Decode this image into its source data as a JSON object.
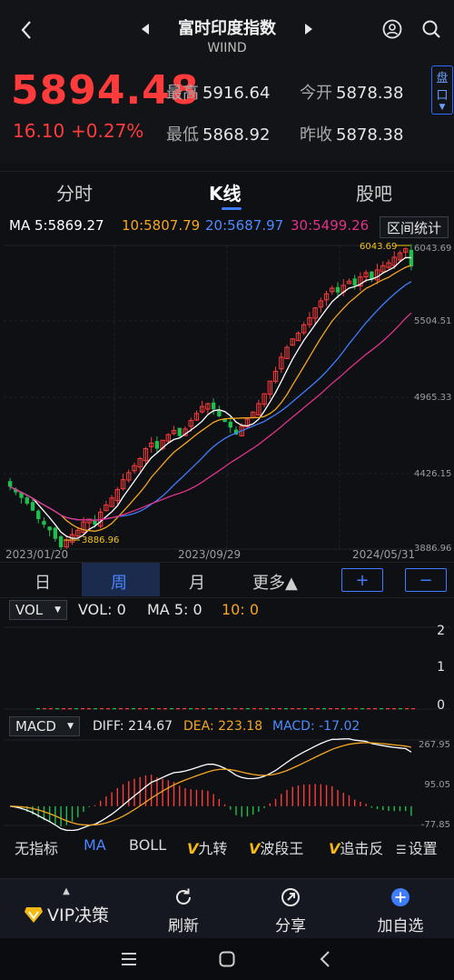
{
  "header": {
    "title": "富时印度指数",
    "subtitle": "WIIND"
  },
  "quote": {
    "price": "5894.48",
    "change": "16.10",
    "change_pct": "+0.27%",
    "high_label": "最高",
    "high": "5916.64",
    "open_label": "今开",
    "open": "5878.38",
    "low_label": "最低",
    "low": "5868.92",
    "prev_close_label": "昨收",
    "prev_close": "5878.38",
    "side_button": [
      "盘",
      "口"
    ]
  },
  "tabs": {
    "items": [
      "分时",
      "K线",
      "股吧"
    ],
    "active": "K线"
  },
  "ma": {
    "ma5": "MA 5:5869.27",
    "ma10": "10:5807.79",
    "ma20": "20:5687.97",
    "ma30": "30:5499.26",
    "range_button": "区间统计"
  },
  "chart_labels": {
    "y_ticks": [
      "6043.69",
      "5504.51",
      "4965.33",
      "4426.15",
      "3886.96"
    ],
    "x_ticks": [
      "2023/01/20",
      "2023/09/29",
      "2024/05/31"
    ],
    "max_label": "6043.69",
    "min_label": "3886.96"
  },
  "period_bar": {
    "items": [
      "日",
      "周",
      "月",
      "更多▲"
    ],
    "active": "周",
    "plus": "+",
    "minus": "−"
  },
  "vol": {
    "selector": "VOL",
    "vol": "VOL: 0",
    "ma5": "MA 5: 0",
    "ma10": "10: 0",
    "y_ticks": [
      "2",
      "1",
      "0"
    ]
  },
  "macd": {
    "selector": "MACD",
    "diff": "DIFF: 214.67",
    "dea": "DEA: 223.18",
    "macd": "MACD: -17.02",
    "y_ticks": [
      "267.95",
      "95.05",
      "-77.85"
    ]
  },
  "indicators": {
    "items": [
      "无指标",
      "MA",
      "BOLL",
      "九转",
      "波段王",
      "追击反",
      "设置"
    ],
    "vip_mark": "V",
    "active": "MA"
  },
  "bottom": {
    "vip": "VIP决策",
    "refresh": "刷新",
    "share": "分享",
    "watchlist": "加自选"
  },
  "colors": {
    "up": "#ff3b3b",
    "down": "#1fbf4f",
    "ma5": "#ffffff",
    "ma10": "#f5a623",
    "ma20": "#3f7dff",
    "ma30": "#e0338a",
    "accent": "#3f7dff"
  },
  "chart_data": {
    "type": "candlestick",
    "x_ticks": [
      "2023/01/20",
      "2023/09/29",
      "2024/05/31"
    ],
    "y_ticks": [
      6043.69,
      5504.51,
      4965.33,
      4426.15,
      3886.96
    ],
    "ylim": [
      3886.96,
      6043.69
    ],
    "ma_series": [
      {
        "name": "MA 5",
        "last": 5869.27
      },
      {
        "name": "10",
        "last": 5807.79
      },
      {
        "name": "20",
        "last": 5687.97
      },
      {
        "name": "30",
        "last": 5499.26
      }
    ],
    "close_series": [
      4330,
      4290,
      4250,
      4210,
      4160,
      4100,
      4060,
      4020,
      3960,
      3900,
      3950,
      3990,
      4020,
      4080,
      4100,
      4060,
      4150,
      4200,
      4250,
      4310,
      4380,
      4430,
      4480,
      4530,
      4600,
      4640,
      4600,
      4660,
      4700,
      4730,
      4690,
      4740,
      4800,
      4850,
      4900,
      4920,
      4880,
      4830,
      4790,
      4750,
      4700,
      4760,
      4810,
      4860,
      4920,
      4990,
      5080,
      5150,
      5250,
      5320,
      5380,
      5420,
      5480,
      5530,
      5600,
      5650,
      5700,
      5740,
      5710,
      5760,
      5790,
      5760,
      5820,
      5850,
      5800,
      5870,
      5900,
      5920,
      5960,
      5990,
      6020,
      5894
    ],
    "macd": {
      "diff": 214.67,
      "dea": 223.18,
      "macd": -17.02,
      "ylim": [
        -77.85,
        267.95
      ],
      "y_ticks": [
        267.95,
        95.05,
        -77.85
      ]
    },
    "vol": {
      "vol": 0,
      "ma5": 0,
      "ma10": 0,
      "y_ticks": [
        2,
        1,
        0
      ]
    }
  }
}
